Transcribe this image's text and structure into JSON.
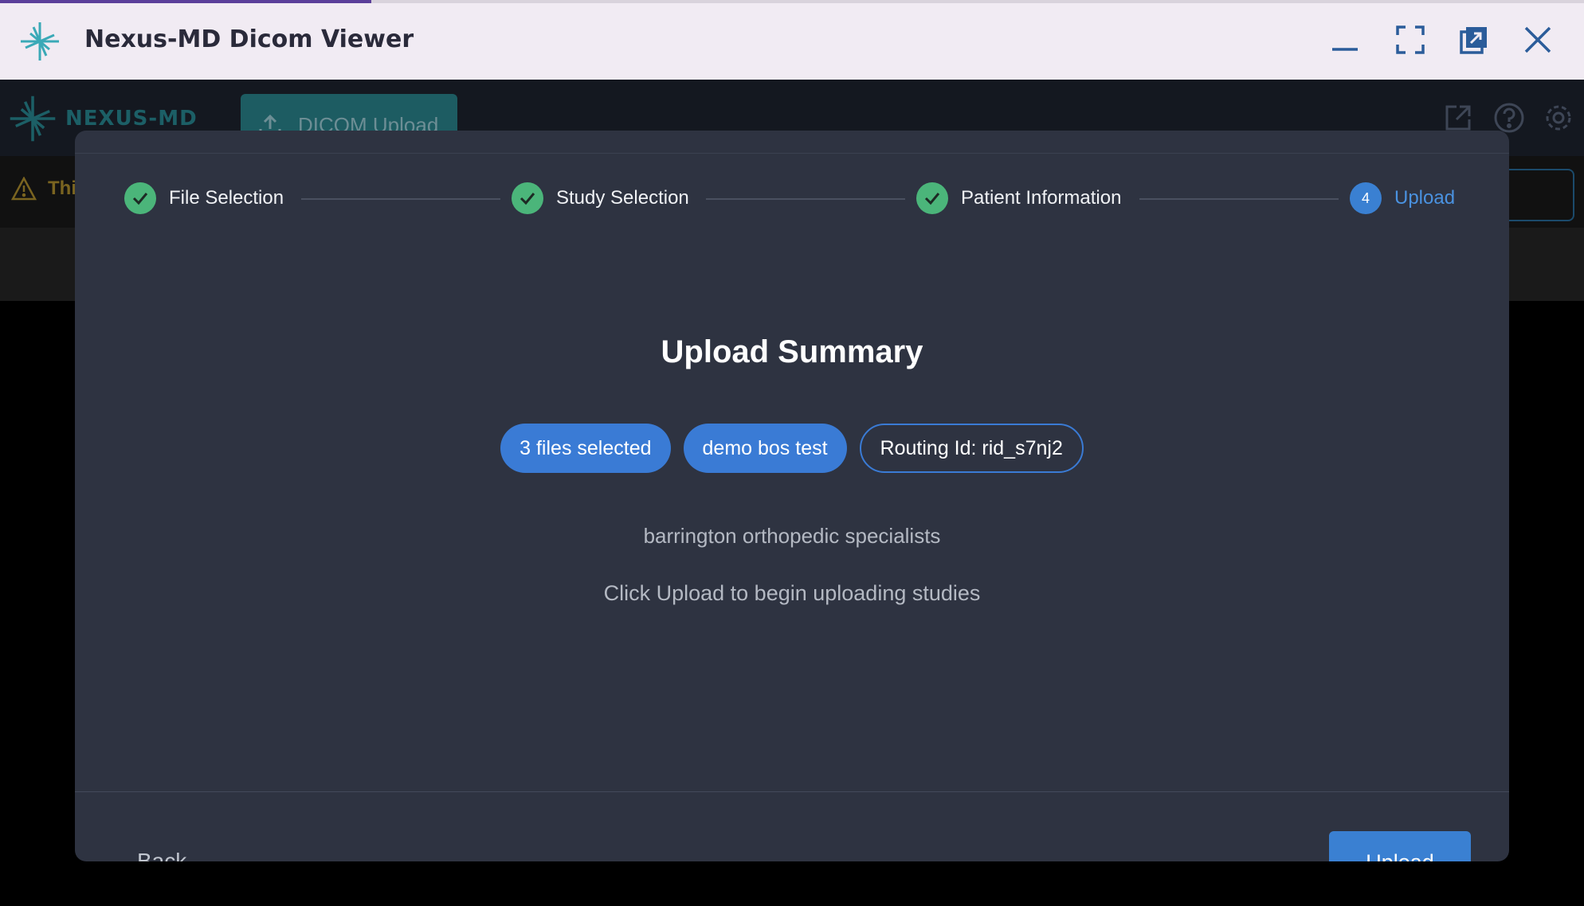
{
  "window": {
    "title": "Nexus-MD Dicom Viewer"
  },
  "app": {
    "logo_text": "NEXUS-MD",
    "tab_label": "DICOM Upload",
    "warning_text": "Thi"
  },
  "stepper": {
    "steps": [
      {
        "label": "File Selection",
        "state": "complete"
      },
      {
        "label": "Study Selection",
        "state": "complete"
      },
      {
        "label": "Patient Information",
        "state": "complete"
      },
      {
        "label": "Upload",
        "state": "active",
        "number": "4"
      }
    ]
  },
  "summary": {
    "title": "Upload Summary",
    "chips": {
      "files": "3 files selected",
      "study": "demo bos test",
      "routing": "Routing Id: rid_s7nj2"
    },
    "organization": "barrington orthopedic specialists",
    "hint": "Click Upload to begin uploading studies"
  },
  "footer": {
    "back_label": "Back",
    "upload_label": "Upload"
  },
  "colors": {
    "accent": "#3a7bd5",
    "success": "#4bb57a",
    "modal_bg": "#2e3341"
  }
}
